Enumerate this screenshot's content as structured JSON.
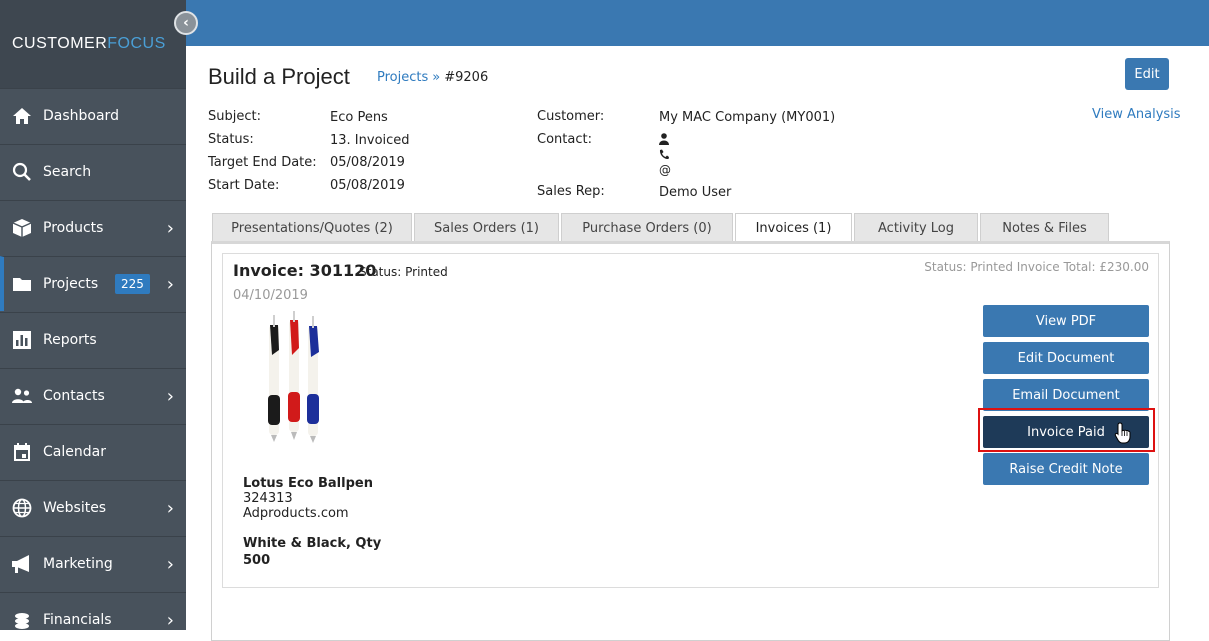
{
  "brand": {
    "part1": "CUSTOMER",
    "part2": "FOCUS"
  },
  "sidebar": {
    "items": [
      {
        "label": "Dashboard",
        "icon": "home-icon",
        "chevron": false
      },
      {
        "label": "Search",
        "icon": "search-icon",
        "chevron": false
      },
      {
        "label": "Products",
        "icon": "box-icon",
        "chevron": true
      },
      {
        "label": "Projects",
        "icon": "folder-icon",
        "chevron": true,
        "badge": "225",
        "active": true
      },
      {
        "label": "Reports",
        "icon": "chart-icon",
        "chevron": false
      },
      {
        "label": "Contacts",
        "icon": "people-icon",
        "chevron": true
      },
      {
        "label": "Calendar",
        "icon": "calendar-icon",
        "chevron": false
      },
      {
        "label": "Websites",
        "icon": "globe-icon",
        "chevron": true
      },
      {
        "label": "Marketing",
        "icon": "megaphone-icon",
        "chevron": true
      },
      {
        "label": "Financials",
        "icon": "coins-icon",
        "chevron": true
      }
    ]
  },
  "header": {
    "title": "Build a Project",
    "breadcrumb_link": "Projects",
    "breadcrumb_sep": "»",
    "breadcrumb_current": "#9206",
    "edit_label": "Edit",
    "view_analysis": "View Analysis"
  },
  "info": {
    "subject_label": "Subject:",
    "subject": "Eco Pens",
    "status_label": "Status:",
    "status": "13. Invoiced",
    "target_label": "Target End Date:",
    "target": "05/08/2019",
    "start_label": "Start Date:",
    "start": "05/08/2019",
    "customer_label": "Customer:",
    "customer": "My MAC Company (MY001)",
    "contact_label": "Contact:",
    "contact_email_symbol": "@",
    "salesrep_label": "Sales Rep:",
    "salesrep": "Demo User"
  },
  "tabs": [
    {
      "label": "Presentations/Quotes (2)"
    },
    {
      "label": "Sales Orders (1)"
    },
    {
      "label": "Purchase Orders (0)"
    },
    {
      "label": "Invoices (1)",
      "active": true
    },
    {
      "label": "Activity Log"
    },
    {
      "label": "Notes & Files"
    }
  ],
  "invoice": {
    "title": "Invoice: 301120",
    "status_label": "Status:",
    "status_value": "Printed",
    "date": "04/10/2019",
    "right_status": "Status: Printed Invoice Total: £230.00",
    "product_name": "Lotus Eco Ballpen",
    "product_code": "324313",
    "supplier": "Adproducts.com",
    "variant": "White & Black, Qty",
    "qty": "500"
  },
  "actions": {
    "view_pdf": "View PDF",
    "edit_document": "Edit Document",
    "email_document": "Email Document",
    "invoice_paid": "Invoice Paid",
    "raise_credit": "Raise Credit Note"
  },
  "colors": {
    "topbar": "#3a78b1",
    "sidebar": "#48525c",
    "accent": "#2f7bbf",
    "highlight_border": "#dd1111"
  }
}
